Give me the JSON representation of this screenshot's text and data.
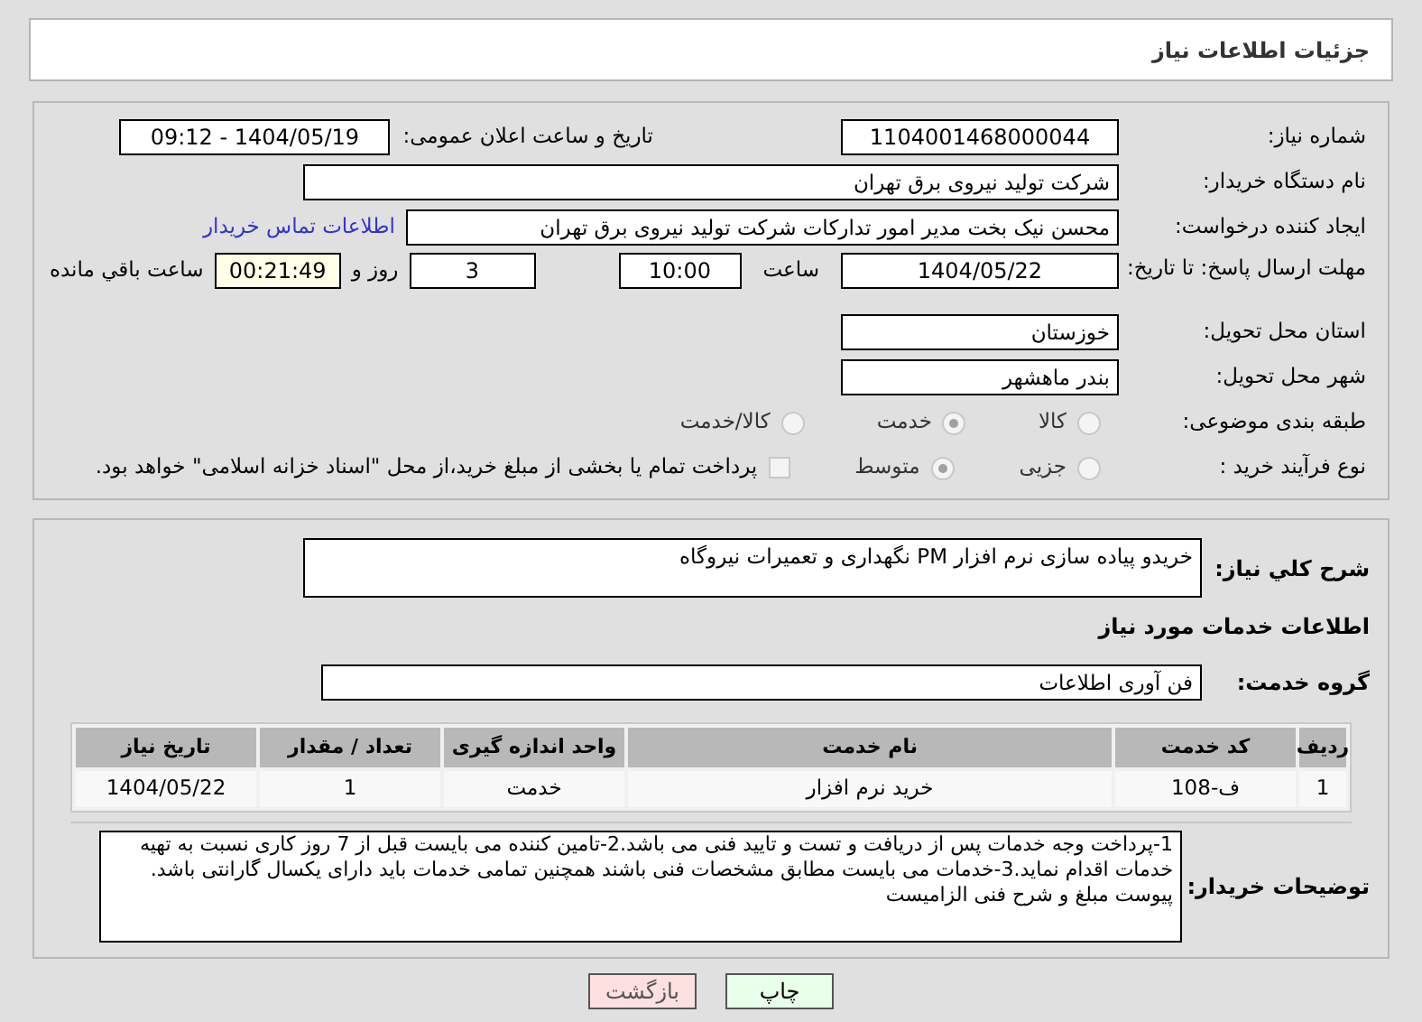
{
  "header": {
    "title": "جزئیات اطلاعات نیاز"
  },
  "fields": {
    "need_number": {
      "label": "شماره نیاز:",
      "value": "1104001468000044"
    },
    "announce": {
      "label": "تاریخ و ساعت اعلان عمومی:",
      "value": "1404/05/19 - 09:12"
    },
    "buyer": {
      "label": "نام دستگاه خریدار:",
      "value": "شرکت تولید نیروی برق تهران"
    },
    "creator": {
      "label": "ایجاد کننده درخواست:",
      "value": "محسن نیک بخت مدیر امور تدارکات شرکت تولید نیروی برق تهران"
    },
    "contact_link": "اطلاعات تماس خریدار",
    "deadline": {
      "label": "مهلت ارسال پاسخ: تا تاریخ:",
      "date": "1404/05/22",
      "time_label": "ساعت",
      "time": "10:00",
      "days": "3",
      "days_label": "روز و",
      "remaining": "00:21:49",
      "remaining_label": "ساعت باقي مانده"
    },
    "province": {
      "label": "استان محل تحویل:",
      "value": "خوزستان"
    },
    "city": {
      "label": "شهر محل تحویل:",
      "value": "بندر ماهشهر"
    },
    "category": {
      "label": "طبقه بندی موضوعی:",
      "options": [
        {
          "label": "کالا",
          "selected": false
        },
        {
          "label": "خدمت",
          "selected": true
        },
        {
          "label": "کالا/خدمت",
          "selected": false
        }
      ]
    },
    "process": {
      "label": "نوع فرآیند خرید :",
      "options": [
        {
          "label": "جزیی",
          "selected": false
        },
        {
          "label": "متوسط",
          "selected": true
        }
      ],
      "payment": {
        "label": "پرداخت تمام یا بخشی از مبلغ خرید،از محل \"اسناد خزانه اسلامی\" خواهد بود.",
        "checked": false
      }
    }
  },
  "summary": {
    "label": "شرح کلي نياز:",
    "value": "خریدو پیاده سازی نرم افزار PM نگهداری و تعمیرات نیروگاه"
  },
  "services_title": "اطلاعات خدمات مورد نیاز",
  "service_group": {
    "label": "گروه خدمت:",
    "value": "فن آوری اطلاعات"
  },
  "table": {
    "columns": [
      "ردیف",
      "کد خدمت",
      "نام خدمت",
      "واحد اندازه گیری",
      "تعداد / مقدار",
      "تاریخ نیاز"
    ],
    "rows": [
      [
        "1",
        "ف-108",
        "خرید نرم افزار",
        "خدمت",
        "1",
        "1404/05/22"
      ]
    ]
  },
  "buyer_notes": {
    "label": "توضیحات خریدار:",
    "lines": [
      "1-پرداخت وجه خدمات پس از دریافت و تست و تایید فنی می باشد.2-تامین کننده می بایست قبل از 7 روز کاری نسبت به تهیه خدمات اقدام نماید.3-خدمات می بایست مطابق مشخصات فنی باشند همچنین تمامی خدمات باید دارای یکسال گارانتی باشد.",
      "پیوست مبلغ و شرح فنی الزامیست"
    ]
  },
  "buttons": [
    {
      "label": "چاپ",
      "kind": "print"
    },
    {
      "label": "بازگشت",
      "kind": "back"
    }
  ]
}
